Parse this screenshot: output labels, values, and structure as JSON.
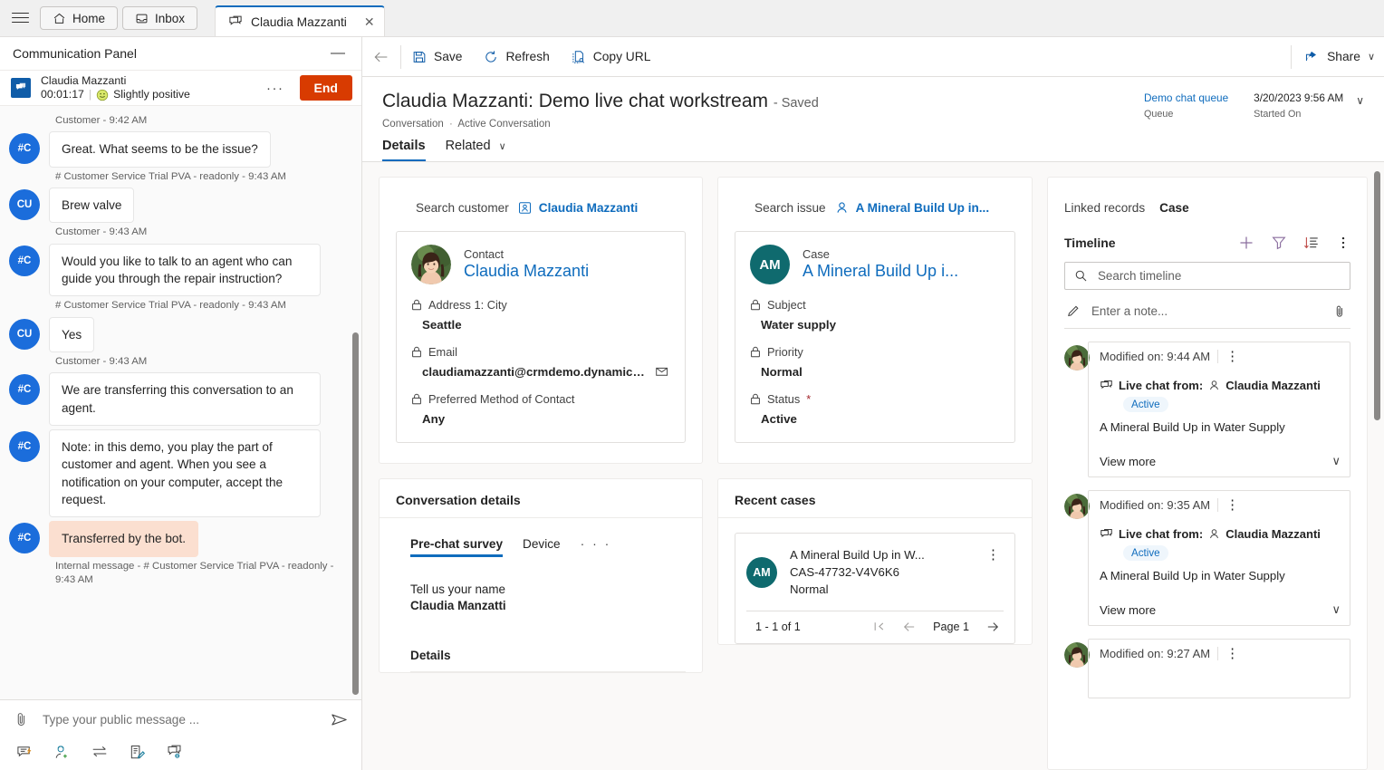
{
  "tabbar": {
    "menu_icon": "hamburger-icon",
    "tabs": [
      {
        "label": "Home",
        "icon": "home-icon"
      },
      {
        "label": "Inbox",
        "icon": "inbox-icon"
      }
    ],
    "active_tab": {
      "label": "Claudia Mazzanti",
      "icon": "chat-icon",
      "close": "✕"
    }
  },
  "comm_panel": {
    "title": "Communication Panel",
    "minimize": "—",
    "conversation": {
      "name": "Claudia Mazzanti",
      "timer": "00:01:17",
      "separator": "|",
      "sentiment": "Slightly positive",
      "sentiment_icon": "smiley-icon",
      "overflow": "···",
      "end_label": "End"
    },
    "messages": [
      {
        "type": "stamp",
        "text": "Customer - 9:42 AM"
      },
      {
        "type": "bubble",
        "initials": "#C",
        "text": "Great. What seems to be the issue?",
        "internal": false
      },
      {
        "type": "stamp",
        "text": "# Customer Service Trial PVA - readonly - 9:43 AM"
      },
      {
        "type": "bubble",
        "initials": "CU",
        "text": "Brew valve",
        "internal": false
      },
      {
        "type": "stamp",
        "text": "Customer - 9:43 AM"
      },
      {
        "type": "bubble",
        "initials": "#C",
        "text": "Would you like to talk to an agent who can guide you through the repair instruction?",
        "internal": false
      },
      {
        "type": "stamp",
        "text": "# Customer Service Trial PVA - readonly - 9:43 AM"
      },
      {
        "type": "bubble",
        "initials": "CU",
        "text": "Yes",
        "internal": false
      },
      {
        "type": "stamp",
        "text": "Customer - 9:43 AM"
      },
      {
        "type": "bubble",
        "initials": "#C",
        "text": "We are transferring this conversation to an agent.",
        "internal": false
      },
      {
        "type": "bubble",
        "initials": "#C",
        "text": "Note: in this demo, you play the part of customer and agent. When you see a notification on your computer, accept the request.",
        "internal": false
      },
      {
        "type": "bubble",
        "initials": "#C",
        "text": "Transferred by the bot.",
        "internal": true
      },
      {
        "type": "stamp",
        "text": "Internal message - # Customer Service Trial PVA - readonly - 9:43 AM"
      }
    ],
    "composer": {
      "attach_icon": "paperclip-icon",
      "placeholder": "Type your public message ...",
      "send_icon": "send-icon",
      "tools": [
        {
          "icon": "quick-reply-icon"
        },
        {
          "icon": "agent-consult-icon"
        },
        {
          "icon": "transfer-icon"
        },
        {
          "icon": "notes-icon"
        },
        {
          "icon": "linked-conversation-icon"
        }
      ]
    }
  },
  "command_bar": {
    "back_icon": "back-arrow-icon",
    "buttons": [
      {
        "label": "Save",
        "icon": "save-icon"
      },
      {
        "label": "Refresh",
        "icon": "refresh-icon"
      },
      {
        "label": "Copy URL",
        "icon": "copy-url-icon"
      }
    ],
    "share_label": "Share",
    "share_icon": "share-icon",
    "share_chevron": "∨"
  },
  "record_header": {
    "title": "Claudia Mazzanti: Demo live chat workstream",
    "saved_state": "- Saved",
    "breadcrumb_entity": "Conversation",
    "breadcrumb_sep": "·",
    "breadcrumb_view": "Active Conversation",
    "fields": [
      {
        "value": "Demo chat queue",
        "label": "Queue",
        "link": true
      },
      {
        "value": "3/20/2023 9:56 AM",
        "label": "Started On",
        "link": false
      }
    ],
    "expand_chevron": "∨",
    "tabs": [
      {
        "label": "Details",
        "selected": true
      },
      {
        "label": "Related",
        "selected": false,
        "chevron": "∨"
      }
    ]
  },
  "customer_section": {
    "search_label": "Search customer",
    "search_value": "Claudia Mazzanti",
    "search_icon": "contact-icon",
    "card": {
      "kind": "Contact",
      "name": "Claudia Mazzanti",
      "avatar": "photo-avatar",
      "fields": [
        {
          "label": "Address 1: City",
          "value": "Seattle",
          "lock": "lock-icon",
          "required": false,
          "mail": false
        },
        {
          "label": "Email",
          "value": "claudiamazzanti@crmdemo.dynamics....",
          "lock": "lock-icon",
          "required": false,
          "mail": true
        },
        {
          "label": "Preferred Method of Contact",
          "value": "Any",
          "lock": "lock-icon",
          "required": false,
          "mail": false
        }
      ]
    }
  },
  "issue_section": {
    "search_label": "Search issue",
    "search_value": "A Mineral Build Up in...",
    "search_icon": "person-icon",
    "card": {
      "kind": "Case",
      "name": "A Mineral Build Up i...",
      "initials": "AM",
      "avatar_color": "#0f6a6e",
      "fields": [
        {
          "label": "Subject",
          "value": "Water supply",
          "lock": "lock-icon",
          "required": false,
          "mail": false
        },
        {
          "label": "Priority",
          "value": "Normal",
          "lock": "lock-icon",
          "required": false,
          "mail": false
        },
        {
          "label": "Status",
          "value": "Active",
          "lock": "lock-icon",
          "required": true,
          "mail": false
        }
      ]
    }
  },
  "conversation_details": {
    "title": "Conversation details",
    "tabs": [
      {
        "label": "Pre-chat survey",
        "selected": true
      },
      {
        "label": "Device",
        "selected": false
      }
    ],
    "more": "· · ·",
    "question": "Tell us your name",
    "answer": "Claudia Manzatti",
    "details_heading": "Details"
  },
  "recent_cases": {
    "title": "Recent cases",
    "items": [
      {
        "initials": "AM",
        "title": "A Mineral Build Up in W...",
        "number": "CAS-47732-V4V6K6",
        "priority": "Normal",
        "kebab": "⋮"
      }
    ],
    "pager": {
      "range": "1 - 1 of 1",
      "first_icon": "first-page-icon",
      "prev_icon": "prev-page-icon",
      "page_label": "Page 1",
      "next_icon": "next-page-icon"
    }
  },
  "linked_records": {
    "label": "Linked records",
    "value": "Case"
  },
  "timeline": {
    "title": "Timeline",
    "actions": [
      {
        "icon": "plus-icon",
        "name": "add-record"
      },
      {
        "icon": "filter-icon",
        "name": "filter"
      },
      {
        "icon": "sort-icon",
        "name": "sort"
      },
      {
        "icon": "kebab-icon",
        "name": "more-commands"
      }
    ],
    "search_placeholder": "Search timeline",
    "search_icon": "search-icon",
    "note_placeholder": "Enter a note...",
    "note_icon": "pencil-icon",
    "note_attach_icon": "paperclip-icon",
    "items": [
      {
        "modified": "Modified on: 9:44 AM",
        "kebab": "⋮",
        "channel_icon": "live-chat-icon",
        "from_label": "Live chat from:",
        "person_icon": "person-icon",
        "from_name": "Claudia Mazzanti",
        "status": "Active",
        "description": "A Mineral Build Up in Water Supply",
        "view_more": "View more",
        "chevron": "∨"
      },
      {
        "modified": "Modified on: 9:35 AM",
        "kebab": "⋮",
        "channel_icon": "live-chat-icon",
        "from_label": "Live chat from:",
        "person_icon": "person-icon",
        "from_name": "Claudia Mazzanti",
        "status": "Active",
        "description": "A Mineral Build Up in Water Supply",
        "view_more": "View more",
        "chevron": "∨"
      },
      {
        "modified": "Modified on: 9:27 AM",
        "kebab": "⋮",
        "channel_icon": "live-chat-icon",
        "from_label": "",
        "person_icon": "person-icon",
        "from_name": "",
        "status": "",
        "description": "",
        "view_more": "",
        "chevron": ""
      }
    ]
  },
  "colors": {
    "accent": "#0f6cbd",
    "end_button": "#d83b01",
    "case_avatar": "#0f6a6e",
    "bot_avatar": "#1b6ddb",
    "internal_bubble": "#fbdfd0"
  }
}
